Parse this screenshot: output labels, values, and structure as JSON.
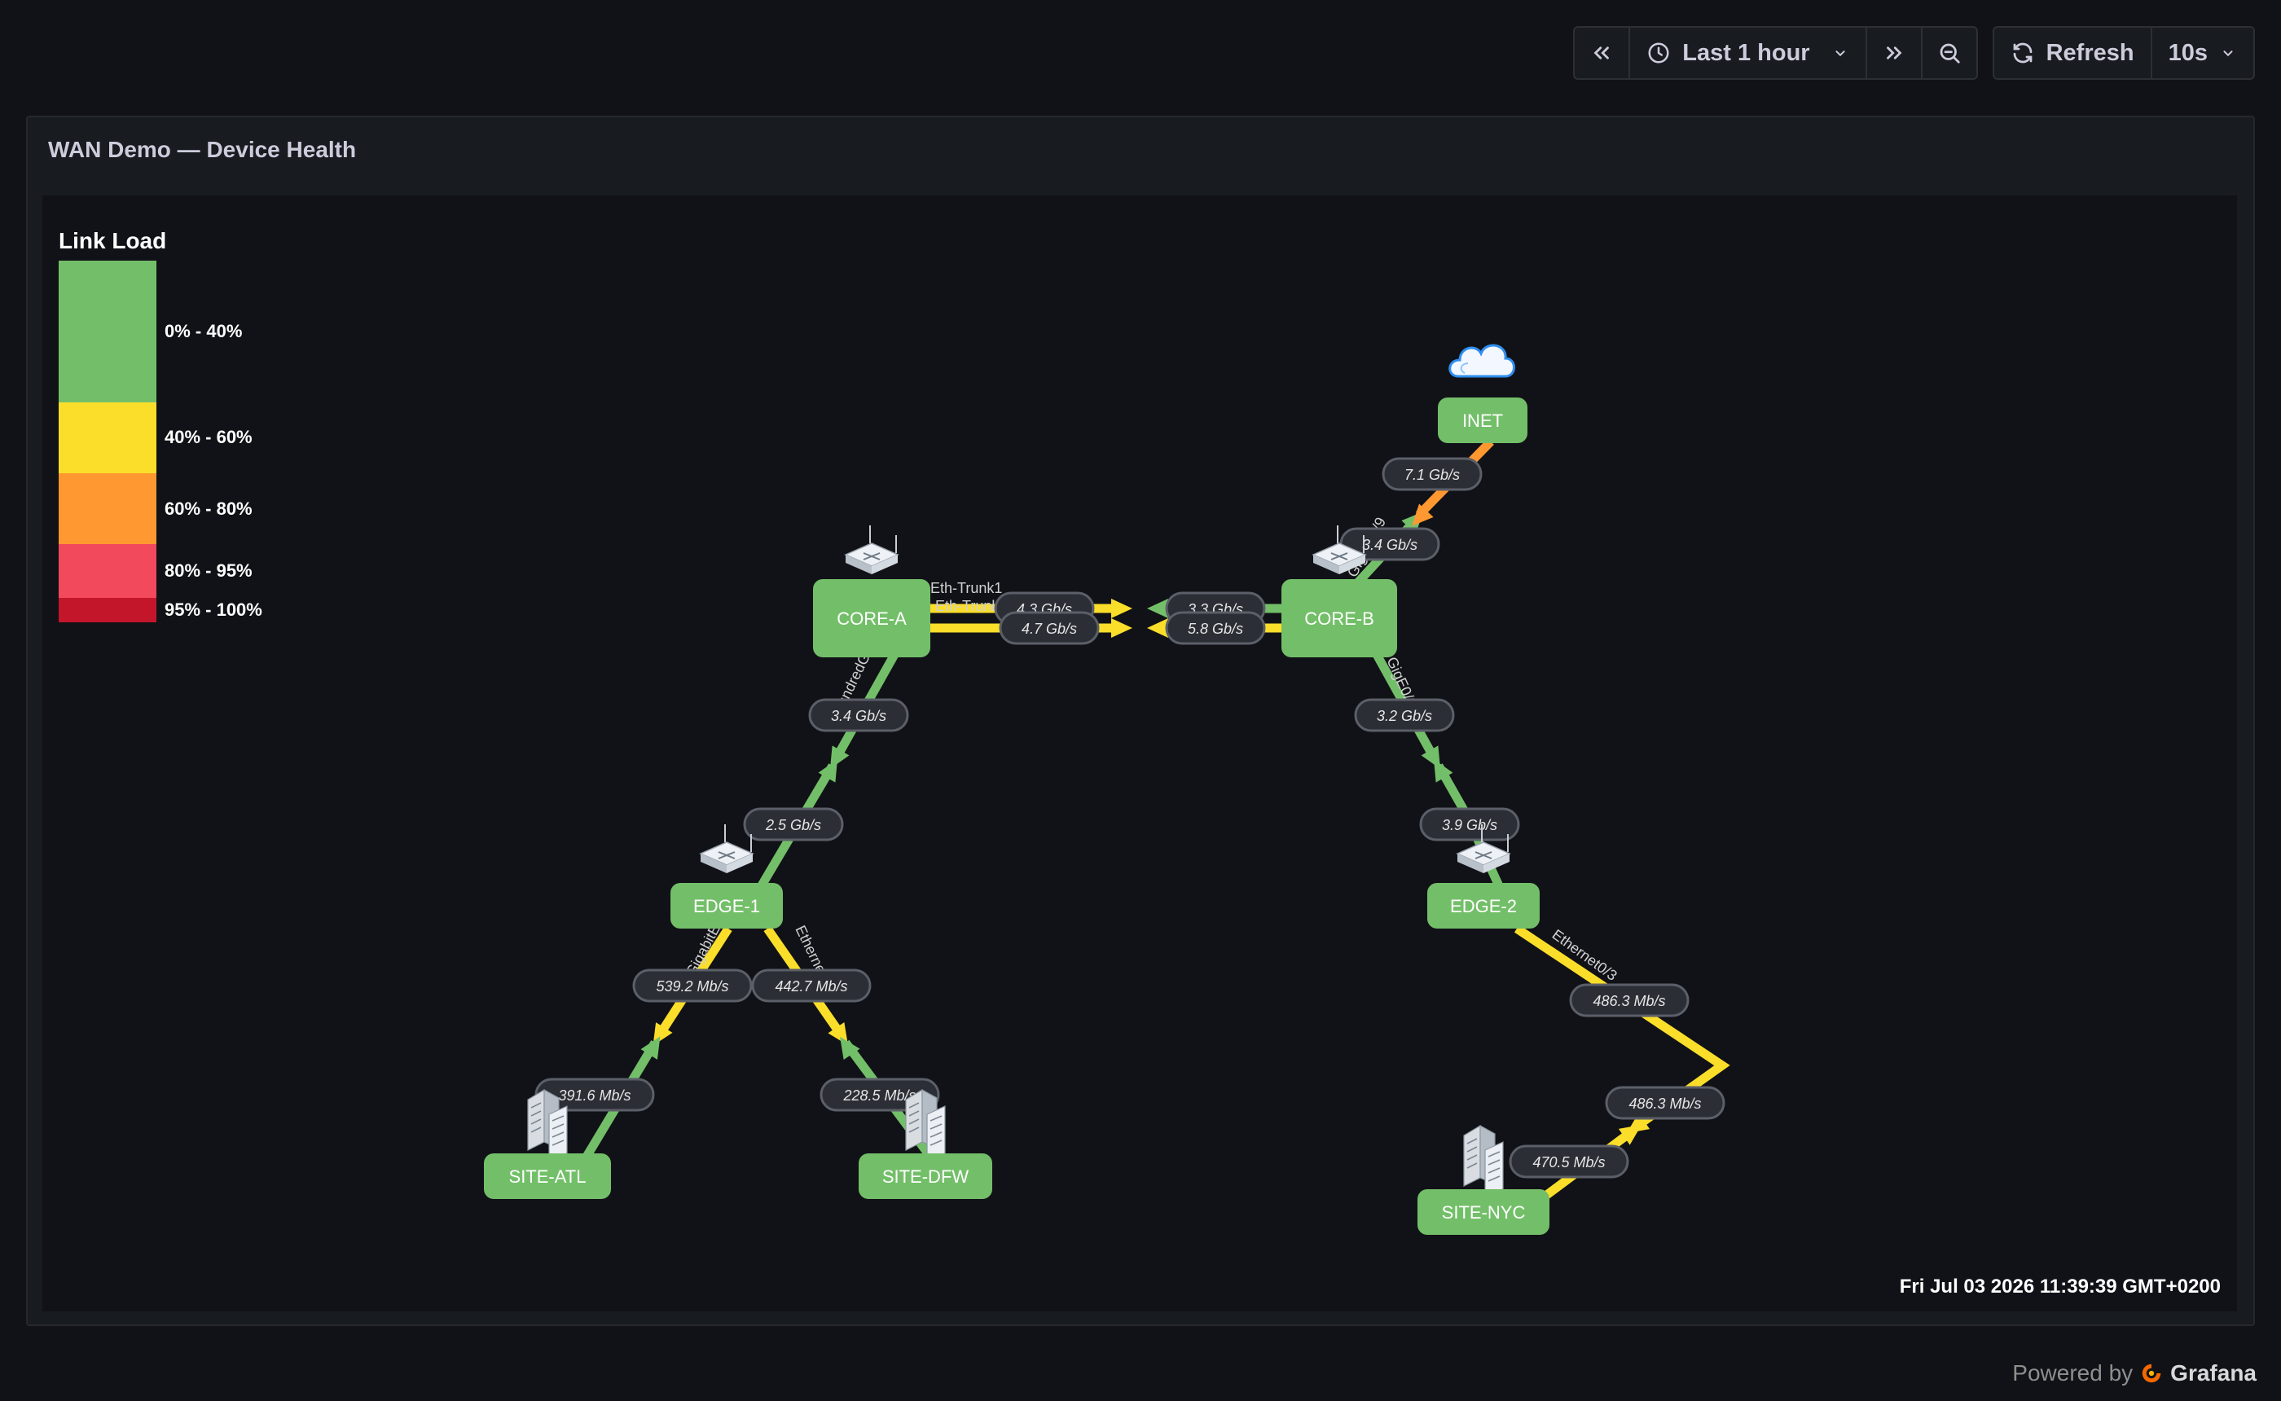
{
  "toolbar": {
    "time_range_label": "Last 1 hour",
    "refresh_label": "Refresh",
    "refresh_interval": "10s"
  },
  "panel": {
    "title": "WAN Demo — Device Health",
    "timestamp": "Fri Jul 03 2026 11:39:39 GMT+0200"
  },
  "legend": {
    "title": "Link Load",
    "ranges": [
      {
        "label": "0% - 40%",
        "color": "#73bf69"
      },
      {
        "label": "40% - 60%",
        "color": "#fade2a"
      },
      {
        "label": "60% - 80%",
        "color": "#ff9830"
      },
      {
        "label": "80% - 95%",
        "color": "#f2495c"
      },
      {
        "label": "95% - 100%",
        "color": "#c4162a"
      }
    ]
  },
  "nodes": [
    {
      "id": "INET",
      "label": "INET",
      "icon": "cloud-icon"
    },
    {
      "id": "CORE-A",
      "label": "CORE-A",
      "icon": "router-icon"
    },
    {
      "id": "CORE-B",
      "label": "CORE-B",
      "icon": "router-icon"
    },
    {
      "id": "EDGE-1",
      "label": "EDGE-1",
      "icon": "router-icon"
    },
    {
      "id": "EDGE-2",
      "label": "EDGE-2",
      "icon": "router-icon"
    },
    {
      "id": "SITE-ATL",
      "label": "SITE-ATL",
      "icon": "building-icon"
    },
    {
      "id": "SITE-DFW",
      "label": "SITE-DFW",
      "icon": "building-icon"
    },
    {
      "id": "SITE-NYC",
      "label": "SITE-NYC",
      "icon": "building-icon"
    }
  ],
  "links": [
    {
      "from": "CORE-A",
      "to": "CORE-B",
      "interface": "Eth-Trunk1",
      "a_rate": "4.3 Gb/s",
      "b_rate": "3.3 Gb/s"
    },
    {
      "from": "CORE-A",
      "to": "CORE-B",
      "interface": "Eth-Trunk2",
      "a_rate": "4.7 Gb/s",
      "b_rate": "5.8 Gb/s"
    },
    {
      "from": "CORE-B",
      "to": "INET",
      "interface": "GigE0/0/9",
      "a_rate": "3.4 Gb/s",
      "b_rate": "7.1 Gb/s"
    },
    {
      "from": "CORE-A",
      "to": "EDGE-1",
      "interface": "HundredGigE",
      "a_rate": "3.4 Gb/s",
      "b_rate": "2.5 Gb/s"
    },
    {
      "from": "CORE-B",
      "to": "EDGE-2",
      "interface": "GigE0/0/1",
      "a_rate": "3.2 Gb/s",
      "b_rate": "3.9 Gb/s"
    },
    {
      "from": "EDGE-1",
      "to": "SITE-ATL",
      "interface": "GigabitEth",
      "a_rate": "539.2 Mb/s",
      "b_rate": "391.6 Mb/s"
    },
    {
      "from": "EDGE-1",
      "to": "SITE-DFW",
      "interface": "Ethernet0/2",
      "a_rate": "442.7 Mb/s",
      "b_rate": "228.5 Mb/s"
    },
    {
      "from": "EDGE-2",
      "to": "SITE-NYC",
      "interface": "Ethernet0/3",
      "a_rate": "486.3 Mb/s",
      "b_rate": "486.3 Mb/s",
      "c_rate": "470.5 Mb/s"
    }
  ],
  "footer": {
    "powered_by": "Powered by",
    "brand": "Grafana"
  }
}
